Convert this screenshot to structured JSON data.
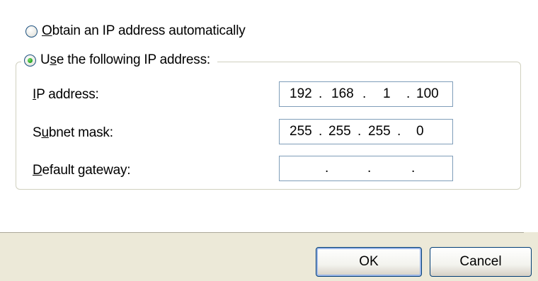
{
  "auto_option": {
    "mnemonic": "O",
    "rest": "btain an IP address automatically",
    "selected": false
  },
  "manual_option": {
    "pre": "U",
    "mnemonic": "s",
    "rest": "e the following IP address:",
    "selected": true
  },
  "fields": {
    "ip_address": {
      "label_mnemonic": "I",
      "label_rest": "P address:",
      "octets": [
        "192",
        "168",
        "1",
        "100"
      ]
    },
    "subnet_mask": {
      "label_pre": "S",
      "label_mnemonic": "u",
      "label_rest": "bnet mask:",
      "octets": [
        "255",
        "255",
        "255",
        "0"
      ]
    },
    "default_gateway": {
      "label_mnemonic": "D",
      "label_rest": "efault gateway:",
      "octets": [
        "",
        "",
        "",
        ""
      ]
    }
  },
  "separator": ".",
  "buttons": {
    "ok": "OK",
    "cancel": "Cancel"
  },
  "colors": {
    "footer_bg": "#ece9d8",
    "default_button_glow": "#9bb6e8",
    "radio_dot": "#21a121"
  }
}
